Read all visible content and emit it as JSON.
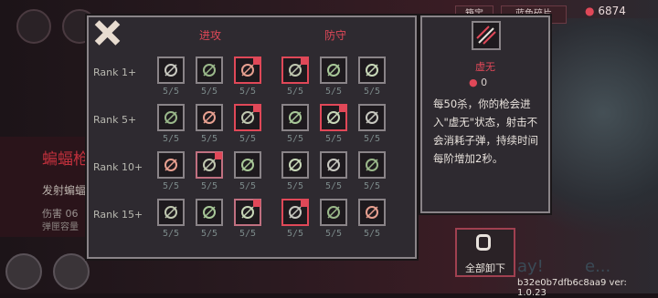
{
  "hud": {
    "currency_value": "6874",
    "btn1": "箱宝",
    "btn2": "蓝色碎片"
  },
  "background": {
    "title": "蝙蝠枪",
    "subtitle": "发射蝙蝠",
    "stat1": "伤害 06",
    "stat2": "弹匣容量",
    "logo_text": "ay!",
    "logo_text2": "e..."
  },
  "panel": {
    "tab_attack": "进攻",
    "tab_defense": "防守",
    "ranks": [
      "Rank 1+",
      "Rank 5+",
      "Rank 10+",
      "Rank 15+"
    ],
    "rows": [
      {
        "cells": [
          {
            "icon": "slash-lines-icon",
            "level": "5/5",
            "state": "normal"
          },
          {
            "icon": "swirl-icon",
            "level": "5/5",
            "state": "normal"
          },
          {
            "icon": "fist-icon",
            "level": "5/5",
            "state": "selected"
          },
          {
            "icon": "crosshair-icon",
            "level": "5/5",
            "state": "selected"
          },
          {
            "icon": "hand-icon",
            "level": "5/5",
            "state": "normal"
          },
          {
            "icon": "eye-shield-icon",
            "level": "5/5",
            "state": "normal"
          }
        ]
      },
      {
        "cells": [
          {
            "icon": "arrows-icon",
            "level": "5/5",
            "state": "normal"
          },
          {
            "icon": "claw-icon",
            "level": "5/5",
            "state": "normal"
          },
          {
            "icon": "swoosh-icon",
            "level": "5/5",
            "state": "selected"
          },
          {
            "icon": "moon-icon",
            "level": "5/5",
            "state": "normal"
          },
          {
            "icon": "boot-icon",
            "level": "5/5",
            "state": "selected"
          },
          {
            "icon": "leaf-icon",
            "level": "5/5",
            "state": "normal"
          }
        ]
      },
      {
        "cells": [
          {
            "icon": "flask-icon",
            "level": "5/5",
            "state": "normal"
          },
          {
            "icon": "target-icon",
            "level": "5/5",
            "state": "selected-dim"
          },
          {
            "icon": "orb-icon",
            "level": "5/5",
            "state": "normal"
          },
          {
            "icon": "skull-icon",
            "level": "5/5",
            "state": "normal"
          },
          {
            "icon": "hearts-icon",
            "level": "5/5",
            "state": "normal"
          },
          {
            "icon": "scythe-icon",
            "level": "5/5",
            "state": "normal"
          }
        ]
      },
      {
        "cells": [
          {
            "icon": "flame-arrow-icon",
            "level": "5/5",
            "state": "normal"
          },
          {
            "icon": "demon-icon",
            "level": "5/5",
            "state": "normal"
          },
          {
            "icon": "void-bullets-icon",
            "level": "5/5",
            "state": "selected-dim"
          },
          {
            "icon": "cross-heart-icon",
            "level": "5/5",
            "state": "selected"
          },
          {
            "icon": "wings-icon",
            "level": "5/5",
            "state": "normal"
          },
          {
            "icon": "medic-icon",
            "level": "5/5",
            "state": "normal"
          }
        ]
      }
    ]
  },
  "detail": {
    "icon": "void-bullets-icon",
    "name": "虚无",
    "cost": "0",
    "description": "每50杀，你的枪会进入\"虚无\"状态，射击不会消耗子弹，持续时间每阶增加2秒。"
  },
  "unequip": {
    "label": "全部卸下"
  },
  "version": "b32e0b7dfb6c8aa9 ver: 1.0.23",
  "colors": {
    "accent": "#e04858",
    "panel_bg": "#2e2a30",
    "border": "#8a8488"
  }
}
